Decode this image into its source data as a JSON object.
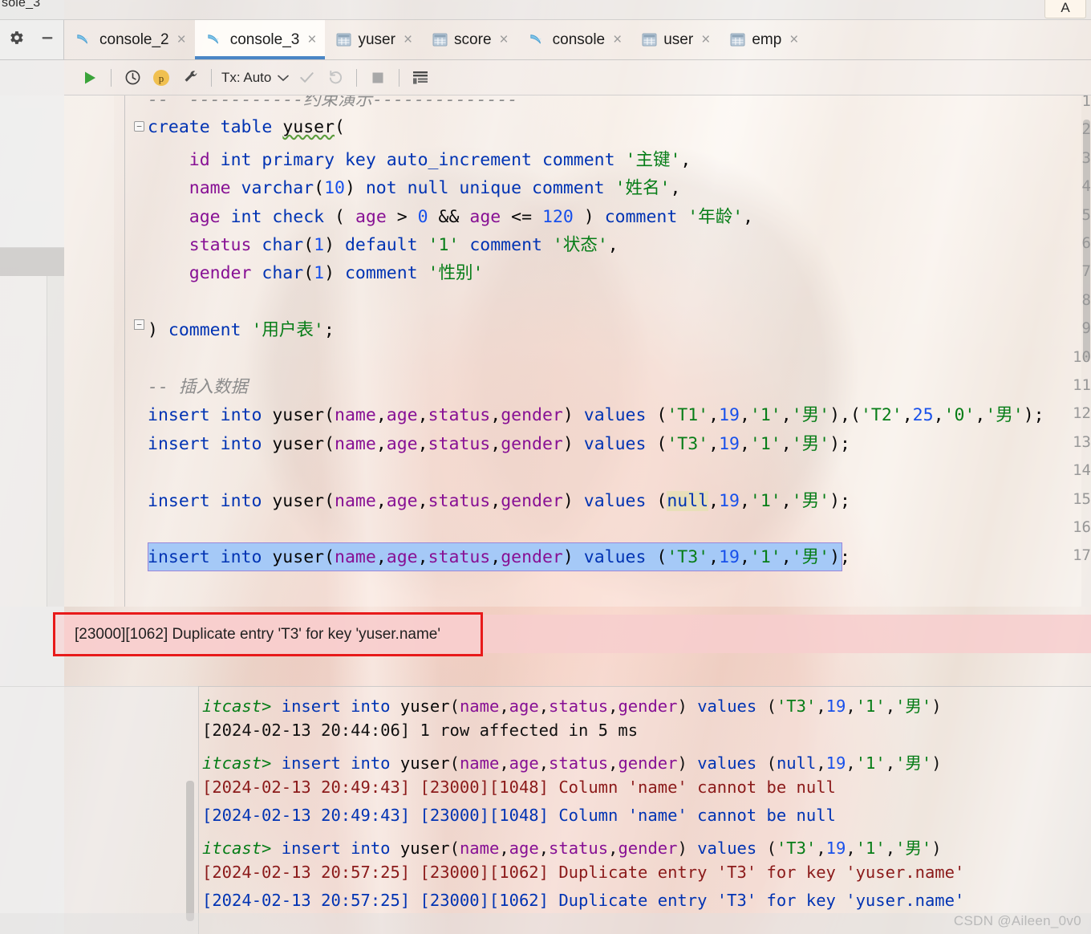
{
  "window": {
    "top_fragment_text": "sole_3",
    "top_right_fragment": "A",
    "watermark": "CSDN @Aileen_0v0"
  },
  "left_tools": {
    "gear_icon": "gear-icon",
    "minimize_icon": "minimize-icon"
  },
  "tabs": [
    {
      "label": "console_2",
      "icon": "dolphin-icon",
      "active": false,
      "close": "×"
    },
    {
      "label": "console_3",
      "icon": "dolphin-icon",
      "active": true,
      "close": "×"
    },
    {
      "label": "yuser",
      "icon": "table-icon",
      "active": false,
      "close": "×"
    },
    {
      "label": "score",
      "icon": "table-icon",
      "active": false,
      "close": "×"
    },
    {
      "label": "console",
      "icon": "dolphin-icon",
      "active": false,
      "close": "×"
    },
    {
      "label": "user",
      "icon": "table-icon",
      "active": false,
      "close": "×"
    },
    {
      "label": "emp",
      "icon": "table-icon",
      "active": false,
      "close": "×"
    }
  ],
  "toolbar": {
    "execute_icon": "play-icon",
    "history_icon": "clock-icon",
    "profile_icon": "p-avatar-icon",
    "settings_icon": "wrench-icon",
    "tx_mode": "Tx: Auto",
    "tx_chevron": "chevron-down-icon",
    "commit_icon": "check-icon",
    "rollback_icon": "rollback-icon",
    "stop_icon": "stop-icon",
    "output_icon": "output-table-icon"
  },
  "editor": {
    "lines": [
      {
        "n": "1",
        "comment_tail": "--  -----------约束演示--------------"
      },
      {
        "n": "2",
        "text": "create table yuser("
      },
      {
        "n": "3",
        "text": "    id int primary key auto_increment comment '主键',"
      },
      {
        "n": "4",
        "text": "    name varchar(10) not null unique comment '姓名',"
      },
      {
        "n": "5",
        "text": "    age int check ( age > 0 && age <= 120 ) comment '年龄',"
      },
      {
        "n": "6",
        "text": "    status char(1) default '1' comment '状态',"
      },
      {
        "n": "7",
        "text": "    gender char(1) comment '性别'"
      },
      {
        "n": "8",
        "text": ""
      },
      {
        "n": "9",
        "text": ") comment '用户表';"
      },
      {
        "n": "10",
        "text": ""
      },
      {
        "n": "11",
        "text": "-- 插入数据"
      },
      {
        "n": "12",
        "text": "insert into yuser(name,age,status,gender) values ('T1',19,'1','男'),('T2',25,'0','男');"
      },
      {
        "n": "13",
        "text": "insert into yuser(name,age,status,gender) values ('T3',19,'1','男');"
      },
      {
        "n": "14",
        "text": ""
      },
      {
        "n": "15",
        "text": "insert into yuser(name,age,status,gender) values (null,19,'1','男');"
      },
      {
        "n": "16",
        "text": ""
      },
      {
        "n": "17",
        "text": "insert into yuser(name,age,status,gender) values ('T3',19,'1','男');"
      }
    ],
    "bulb_icon": "lightbulb-icon",
    "error_gutter_icon": "error-circle-icon",
    "fold_start_icon": "fold-collapse-icon",
    "fold_end_icon": "fold-end-icon"
  },
  "error_banner": {
    "text": "[23000][1062] Duplicate entry 'T3' for key 'yuser.name'",
    "border_color": "#e81a1a",
    "background_color": "#f7cece"
  },
  "console_output": [
    {
      "kind": "query",
      "prompt": "itcast>",
      "sql": "insert into yuser(name,age,status,gender) values ('T3',19,'1','男')"
    },
    {
      "kind": "ok",
      "timestamp": "[2024-02-13 20:44:06]",
      "message": "1 row affected in 5 ms"
    },
    {
      "kind": "query",
      "prompt": "itcast>",
      "sql": "insert into yuser(name,age,status,gender) values (null,19,'1','男')"
    },
    {
      "kind": "error",
      "timestamp": "[2024-02-13 20:49:43]",
      "message": "[23000][1048] Column 'name' cannot be null"
    },
    {
      "kind": "error2",
      "timestamp": "[2024-02-13 20:49:43]",
      "message": "[23000][1048] Column 'name' cannot be null"
    },
    {
      "kind": "query",
      "prompt": "itcast>",
      "sql": "insert into yuser(name,age,status,gender) values ('T3',19,'1','男')"
    },
    {
      "kind": "error",
      "timestamp": "[2024-02-13 20:57:25]",
      "message": "[23000][1062] Duplicate entry 'T3' for key 'yuser.name'"
    },
    {
      "kind": "error2",
      "timestamp": "[2024-02-13 20:57:25]",
      "message": "[23000][1062] Duplicate entry 'T3' for key 'yuser.name'"
    }
  ],
  "colors": {
    "keyword": "#0033b3",
    "string": "#067d17",
    "number": "#1750eb",
    "column": "#871094",
    "comment": "#8c8c8c",
    "accent": "#4a86c5",
    "selection": "#a5c9f7"
  }
}
